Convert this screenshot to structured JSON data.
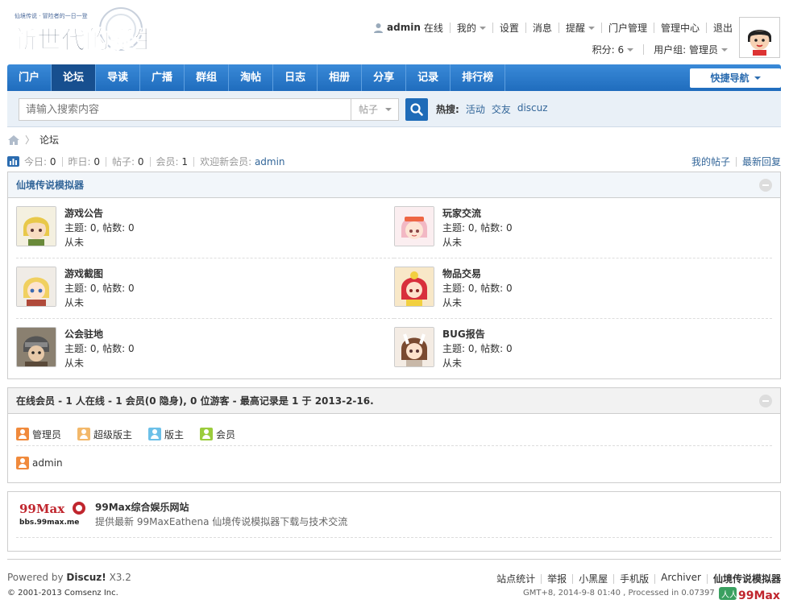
{
  "header": {
    "logo_text": "新世代的誕生",
    "logo_sub": "仙境传说 · 冒险者的一日一登",
    "user": "admin",
    "online": "在线",
    "links": [
      "我的",
      "设置",
      "消息",
      "提醒",
      "门户管理",
      "管理中心",
      "退出"
    ],
    "points": "积分: 6",
    "group": "用户组: 管理员"
  },
  "nav": {
    "items": [
      "门户",
      "论坛",
      "导读",
      "广播",
      "群组",
      "淘帖",
      "日志",
      "相册",
      "分享",
      "记录",
      "排行榜"
    ],
    "active_index": 1,
    "quick_nav": "快捷导航"
  },
  "search": {
    "placeholder": "请输入搜索内容",
    "type": "帖子",
    "hot_label": "热搜:",
    "hot": [
      "活动",
      "交友",
      "discuz"
    ]
  },
  "breadcrumb": {
    "current": "论坛"
  },
  "stats": {
    "today_label": "今日:",
    "today": "0",
    "yesterday_label": "昨日:",
    "yesterday": "0",
    "posts_label": "帖子:",
    "posts": "0",
    "members_label": "会员:",
    "members": "1",
    "welcome_label": "欢迎新会员:",
    "welcome_user": "admin",
    "my_posts": "我的帖子",
    "latest_reply": "最新回复"
  },
  "forum_group": {
    "title": "仙境传说模拟器",
    "forums": [
      {
        "name": "游戏公告",
        "meta": "主题: 0, 帖数: 0",
        "last": "从未"
      },
      {
        "name": "玩家交流",
        "meta": "主题: 0, 帖数: 0",
        "last": "从未"
      },
      {
        "name": "游戏截图",
        "meta": "主题: 0, 帖数: 0",
        "last": "从未"
      },
      {
        "name": "物品交易",
        "meta": "主题: 0, 帖数: 0",
        "last": "从未"
      },
      {
        "name": "公会驻地",
        "meta": "主题: 0, 帖数: 0",
        "last": "从未"
      },
      {
        "name": "BUG报告",
        "meta": "主题: 0, 帖数: 0",
        "last": "从未"
      }
    ]
  },
  "online": {
    "title": "在线会员 - 1 人在线 - 1 会员(0 隐身), 0 位游客 - 最高记录是 1 于 2013-2-16.",
    "legend": [
      {
        "label": "管理员",
        "color": "#f08a3c"
      },
      {
        "label": "超级版主",
        "color": "#f3b86a"
      },
      {
        "label": "版主",
        "color": "#6cc0e8"
      },
      {
        "label": "会员",
        "color": "#9bcc3c"
      }
    ],
    "users": [
      "admin"
    ]
  },
  "links": {
    "logo_top": "99Max",
    "logo_bottom": "bbs.99max.me",
    "title": "99Max综合娱乐网站",
    "desc": "提供最新 99MaxEathena 仙境传说模拟器下载与技术交流"
  },
  "footer": {
    "powered_prefix": "Powered by",
    "powered_brand": "Discuz!",
    "version": "X3.2",
    "copyright": "© 2001-2013 Comsenz Inc.",
    "links": [
      "站点统计",
      "举报",
      "小黑屋",
      "手机版",
      "Archiver",
      "仙境传说模拟器"
    ],
    "gmt": "GMT+8, 2014-9-8 01:40 , Processed in 0.073979 second(s)",
    "logo_text": "99Max"
  }
}
